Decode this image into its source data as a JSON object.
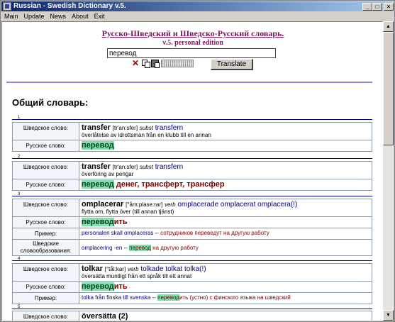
{
  "window": {
    "title": "Russian - Swedish Dictionary v.5.",
    "controls": {
      "minimize": "_",
      "maximize": "□",
      "close": "×"
    }
  },
  "menu": [
    "Main",
    "Update",
    "News",
    "About",
    "Exit"
  ],
  "header": {
    "title": "Русско-Шведский и Шведско-Русский словарь.",
    "subtitle": "v.5. personal edition"
  },
  "search": {
    "value": "перевод",
    "button": "Translate"
  },
  "icons": [
    "delete-icon",
    "copy-icon",
    "paste-icon",
    "keyboard-icon"
  ],
  "section": {
    "title": "Общий словарь:"
  },
  "labels": {
    "swedish_word": "Шведское слово:",
    "russian_word": "Русское слово:",
    "example": "Пример:",
    "compounds": "Шведские словообразования:"
  },
  "entries": [
    {
      "num": "1",
      "headword": "transfer",
      "transcription": "[tr'an:sfer]",
      "pos": "subst",
      "forms": "transfern",
      "definition": "överlåtelse av idrottsman från en klubb till en annan",
      "ru_hl": "перевод",
      "ru_rest": ""
    },
    {
      "num": "2",
      "headword": "transfer",
      "transcription": "[tr'an:sfer]",
      "pos": "subst",
      "forms": "transfern",
      "definition": "överföring av pengar",
      "ru_hl": "перевод",
      "ru_rest": " денег, трансферт, трансфер"
    },
    {
      "num": "3",
      "headword": "omplacerar",
      "transcription": "[°åm:plase:rar]",
      "pos": "verb",
      "forms": "omplacerade omplacerat omplacera(!)",
      "definition_1": "flytta om, flytta över (till annan tjänst)",
      "ru_hl": "перевод",
      "ru_rest": "ить",
      "example_sw": "personalen skall omplaceras",
      "example_sep": " -- ",
      "example_ru": "сотрудников переведут на другую работу",
      "compound_sw": "omplacering -en",
      "compound_sep": " -- ",
      "compound_hl": "перевод",
      "compound_ru": " на другую работу"
    },
    {
      "num": "4",
      "headword": "tolkar",
      "transcription": "[°tål:kar]",
      "pos": "verb",
      "forms": "tolkade tolkat tolka(!)",
      "definition": "översätta muntligt från ett språk till ett annat",
      "ru_hl": "перевод",
      "ru_rest": "ить",
      "example_sw": "tolka från finska till svenska",
      "example_sep": " -- ",
      "example_hl": "перевод",
      "example_ru": "ить (устно) с финского языка на шведский"
    },
    {
      "num": "5",
      "headword": "översätta (2)"
    }
  ]
}
